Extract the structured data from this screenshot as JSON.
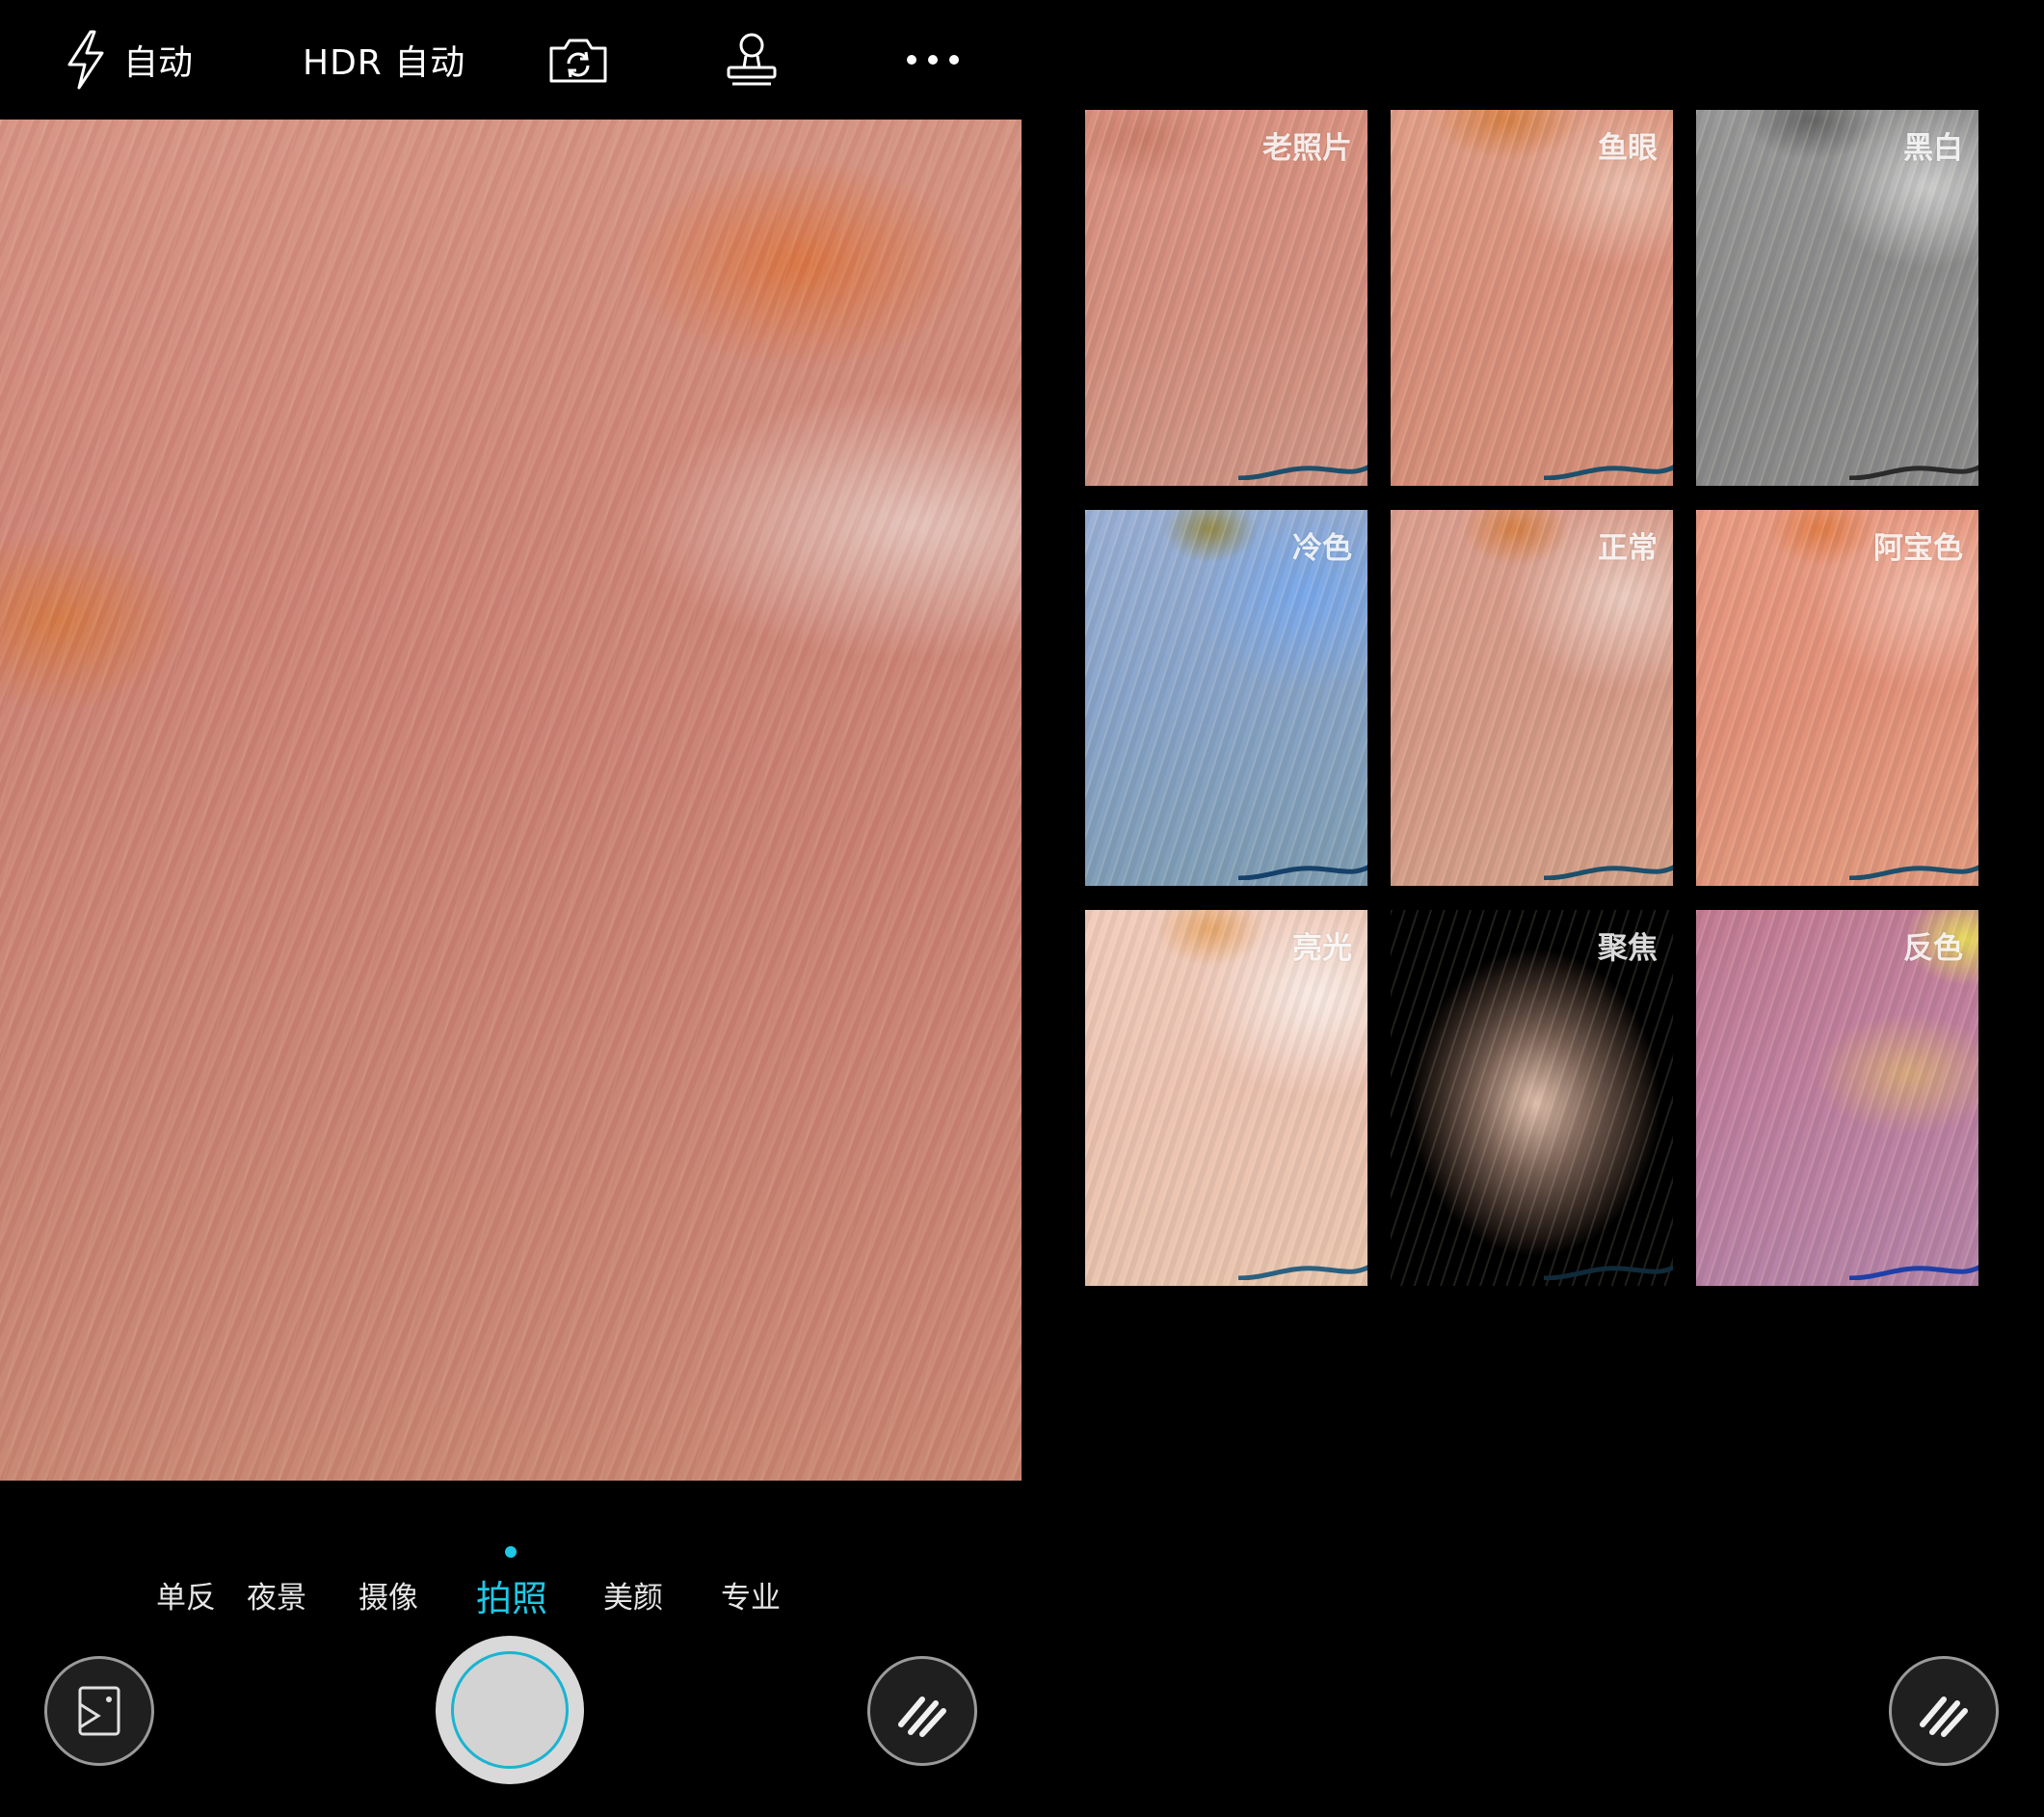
{
  "top_bar": {
    "flash": {
      "icon": "lightning-icon",
      "label": "自动"
    },
    "hdr": {
      "label": "HDR 自动"
    },
    "switch_camera": {
      "icon": "camera-switch-icon"
    },
    "watermark": {
      "icon": "stamp-icon"
    },
    "more": {
      "icon": "more-dots-icon"
    }
  },
  "filters": [
    {
      "label": "老照片"
    },
    {
      "label": "鱼眼"
    },
    {
      "label": "黑白"
    },
    {
      "label": "冷色"
    },
    {
      "label": "正常"
    },
    {
      "label": "阿宝色"
    },
    {
      "label": "亮光"
    },
    {
      "label": "聚焦"
    },
    {
      "label": "反色"
    }
  ],
  "modes": [
    "单反",
    "夜景",
    "摄像",
    "拍照",
    "美颜",
    "专业"
  ],
  "active_mode": "拍照",
  "bottom_controls": {
    "gallery": {
      "icon": "gallery-icon"
    },
    "shutter": {
      "icon": "shutter-icon"
    },
    "filter_left": {
      "icon": "filter-icon"
    },
    "filter_right": {
      "icon": "filter-icon"
    }
  },
  "colors": {
    "accent": "#1ec8e6",
    "background": "#000000"
  }
}
